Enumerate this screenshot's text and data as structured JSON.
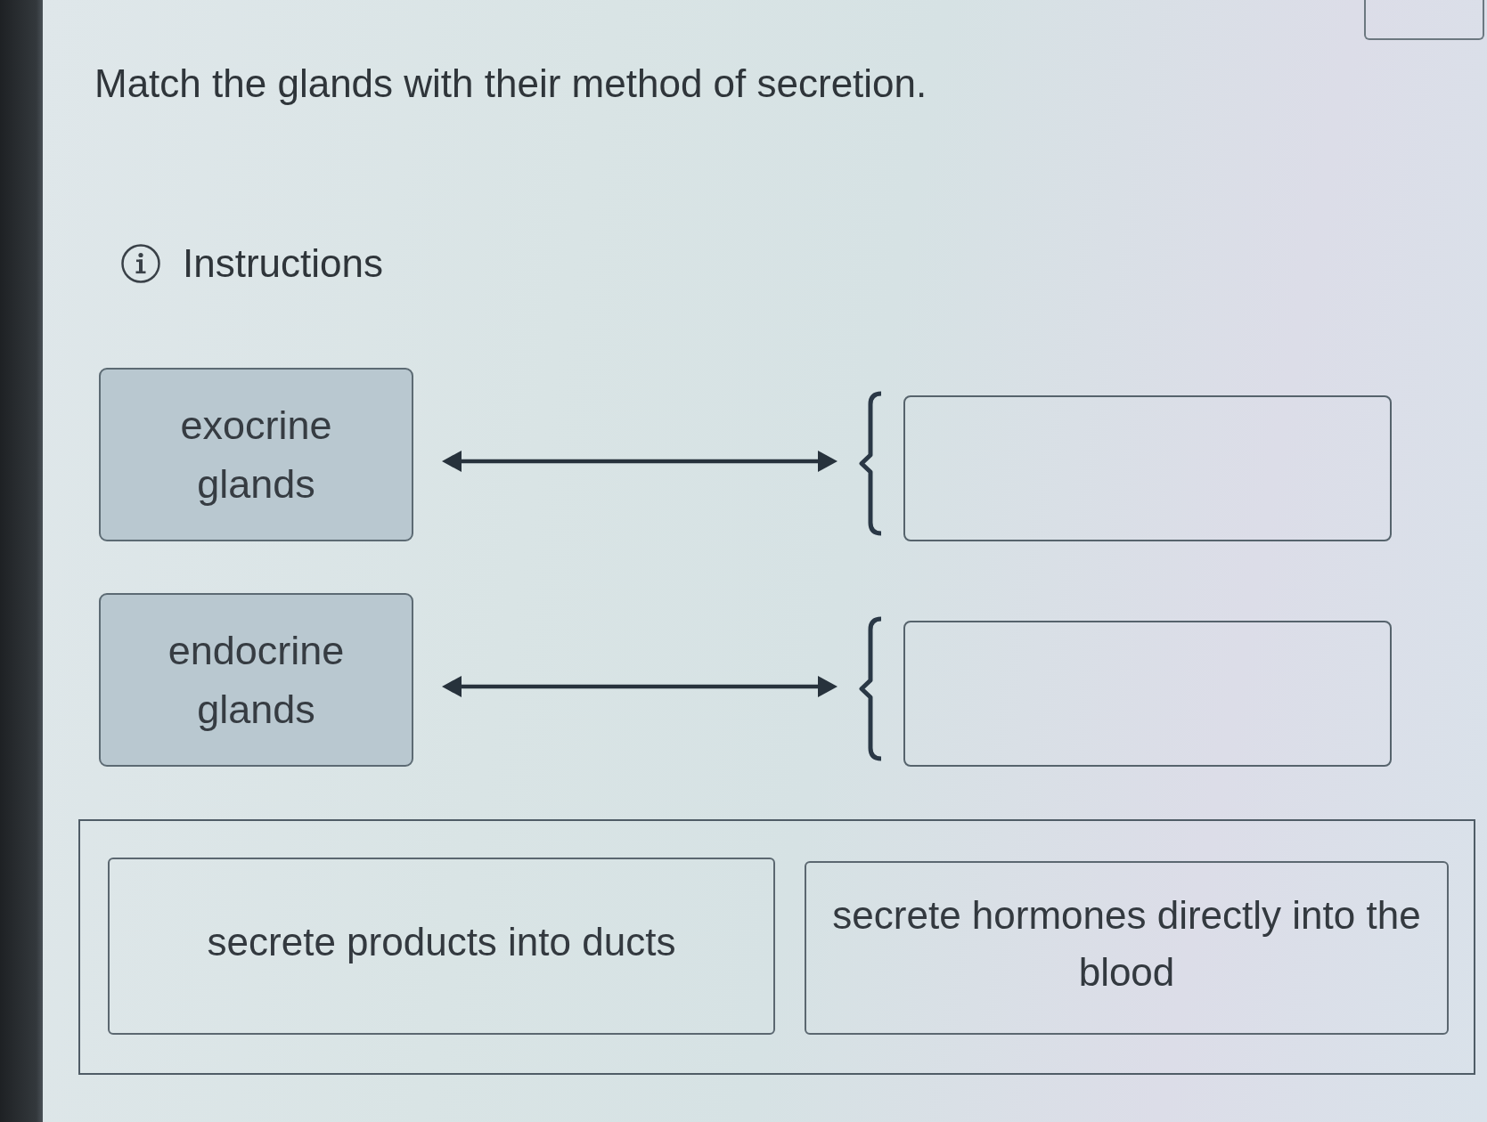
{
  "question": {
    "prompt": "Match the glands with their method of secretion."
  },
  "instructions": {
    "label": "Instructions"
  },
  "match_rows": [
    {
      "term": "exocrine glands"
    },
    {
      "term": "endocrine glands"
    }
  ],
  "answer_bank": {
    "options": [
      {
        "text": "secrete products into ducts"
      },
      {
        "text": "secrete hormones directly into the blood"
      }
    ]
  }
}
